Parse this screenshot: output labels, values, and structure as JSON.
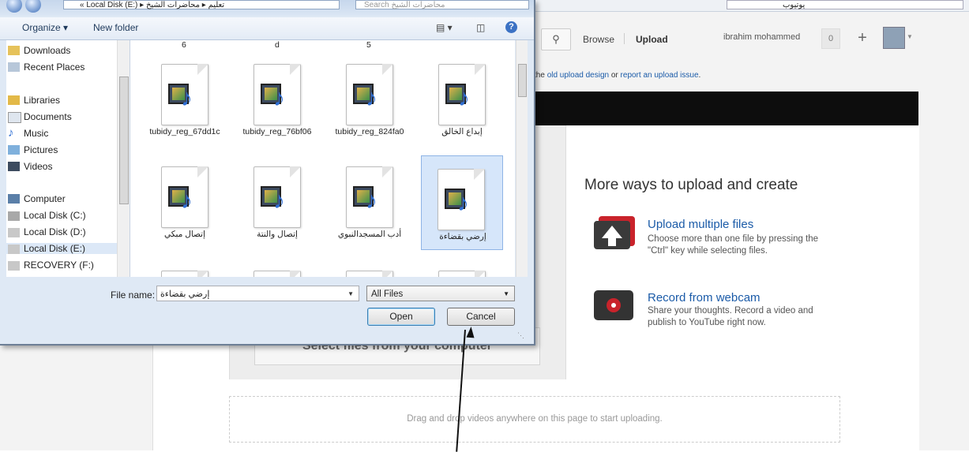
{
  "browser": {
    "address_text": "يوتيوب"
  },
  "youtube": {
    "nav": {
      "browse": "Browse",
      "upload": "Upload",
      "username": "ibrahim mohammed",
      "count": "0",
      "plus": "+"
    },
    "notice": {
      "text_prefix": "the ",
      "link1": "old upload design",
      "text_mid": " or ",
      "link2": "report an upload issue",
      "text_suffix": "."
    },
    "select_files": "Select files from your computer",
    "more_ways": "More ways to upload and create",
    "options": [
      {
        "title": "Upload multiple files",
        "desc": "Choose more than one file by pressing the \"Ctrl\" key while selecting files.",
        "icon": "upload-arrow-icon"
      },
      {
        "title": "Record from webcam",
        "desc": "Share your thoughts. Record a video and publish to YouTube right now.",
        "icon": "webcam-record-icon"
      }
    ],
    "dropzone": "Drag and drop videos anywhere on this page to start uploading."
  },
  "dialog": {
    "path": "« Local Disk (E:) ▸ تعليم ▸ محاضرات الشيخ",
    "search_placeholder": "Search محاضرات الشيخ",
    "toolbar": {
      "organize": "Organize ▾",
      "new_folder": "New folder"
    },
    "nav_items": [
      {
        "label": "Downloads",
        "icon": "downloads-folder-icon"
      },
      {
        "label": "Recent Places",
        "icon": "recent-places-icon"
      },
      {
        "label": "Libraries",
        "icon": "libraries-icon"
      },
      {
        "label": "Documents",
        "icon": "documents-icon"
      },
      {
        "label": "Music",
        "icon": "music-icon"
      },
      {
        "label": "Pictures",
        "icon": "pictures-icon"
      },
      {
        "label": "Videos",
        "icon": "videos-icon"
      },
      {
        "label": "Computer",
        "icon": "computer-icon"
      },
      {
        "label": "Local Disk (C:)",
        "icon": "drive-icon"
      },
      {
        "label": "Local Disk (D:)",
        "icon": "drive-icon"
      },
      {
        "label": "Local Disk (E:)",
        "icon": "drive-icon"
      },
      {
        "label": "RECOVERY (F:)",
        "icon": "drive-icon"
      }
    ],
    "top_partial_labels": [
      "6",
      "d",
      "5"
    ],
    "files": [
      {
        "name": "tubidy_reg_67dd1c"
      },
      {
        "name": "tubidy_reg_76bf06"
      },
      {
        "name": "tubidy_reg_824fa0"
      },
      {
        "name": "إبداع الخالق"
      },
      {
        "name": "إتصال مبكي"
      },
      {
        "name": "إتصال والنتة"
      },
      {
        "name": "أدب المسجدالنبوي"
      },
      {
        "name": "إرضي بقضاءة"
      }
    ],
    "file_name_label": "File name:",
    "file_name_value": "إرضي بقضاءة",
    "file_type": "All Files",
    "open_button": "Open",
    "cancel_button": "Cancel"
  }
}
